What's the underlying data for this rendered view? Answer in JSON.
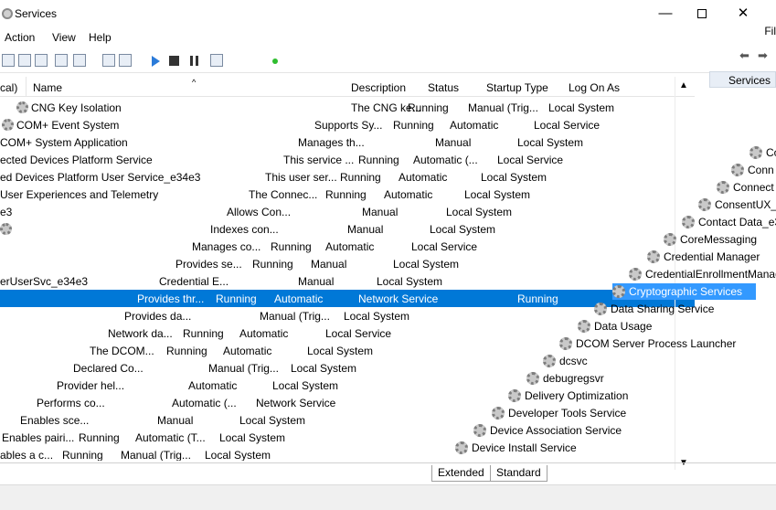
{
  "window": {
    "title": "Services",
    "minimize_glyph": "—",
    "close_glyph": "✕"
  },
  "menu": {
    "action": "Action",
    "view": "View",
    "help": "Help",
    "right_fragment": "Fil"
  },
  "columns": {
    "name_fragment": "cal)",
    "name": "Name",
    "description": "Description",
    "status": "Status",
    "startup_type": "Startup Type",
    "log_on_as": "Log On As"
  },
  "rows": [
    {
      "name": "CNG Key Isolation",
      "desc": "The CNG ke...",
      "status": "Running",
      "startup": "Manual (Trig...",
      "logon": "Local System"
    },
    {
      "name": "COM+ Event System",
      "desc": "Supports Sy...",
      "status": "Running",
      "startup": "Automatic",
      "logon": "Local Service"
    },
    {
      "name": "COM+ System Application",
      "desc": "Manages th...",
      "status": "",
      "startup": "Manual",
      "logon": "Local System"
    },
    {
      "name": "ected Devices Platform Service",
      "desc": "This service ...",
      "status": "Running",
      "startup": "Automatic (...",
      "logon": "Local Service"
    },
    {
      "name": "ed Devices Platform User Service_e34e3",
      "desc": "This user ser...",
      "status": "Running",
      "startup": "Automatic",
      "logon": "Local System"
    },
    {
      "name": "User Experiences and Telemetry",
      "desc": "The Connec...",
      "status": "Running",
      "startup": "Automatic",
      "logon": "Local System"
    },
    {
      "name": "e3",
      "desc": "Allows Con...",
      "status": "",
      "startup": "Manual",
      "logon": "Local System"
    },
    {
      "name": "",
      "desc": "Indexes con...",
      "status": "",
      "startup": "Manual",
      "logon": "Local System"
    },
    {
      "name": "",
      "desc": "Manages co...",
      "status": "Running",
      "startup": "Automatic",
      "logon": "Local Service"
    },
    {
      "name": "",
      "desc": "Provides se...",
      "status": "Running",
      "startup": "Manual",
      "logon": "Local System"
    },
    {
      "name": "erUserSvc_e34e3",
      "desc": "Credential E...",
      "status": "",
      "startup": "Manual",
      "logon": "Local System"
    },
    {
      "name": "",
      "desc": "Provides thr...",
      "status": "Running",
      "startup": "Automatic",
      "logon": "Network Service"
    },
    {
      "name": "",
      "desc": "Provides da...",
      "status": "",
      "startup": "Manual (Trig...",
      "logon": "Local System"
    },
    {
      "name": "",
      "desc": "Network da...",
      "status": "Running",
      "startup": "Automatic",
      "logon": "Local Service"
    },
    {
      "name": "",
      "desc": "The DCOM...",
      "status": "Running",
      "startup": "Automatic",
      "logon": "Local System"
    },
    {
      "name": "",
      "desc": "Declared Co...",
      "status": "",
      "startup": "Manual (Trig...",
      "logon": "Local System"
    },
    {
      "name": "",
      "desc": "Provider hel...",
      "status": "",
      "startup": "Automatic",
      "logon": "Local System"
    },
    {
      "name": "",
      "desc": "Performs co...",
      "status": "",
      "startup": "Automatic (...",
      "logon": "Network Service"
    },
    {
      "name": "",
      "desc": "Enables sce...",
      "status": "",
      "startup": "Manual",
      "logon": "Local System"
    },
    {
      "name": "",
      "desc": "Enables pairi...",
      "status": "Running",
      "startup": "Automatic (T...",
      "logon": "Local System"
    },
    {
      "name": "",
      "desc": "ables a c...",
      "status": "Running",
      "startup": "Manual (Trig...",
      "logon": "Local System"
    }
  ],
  "right_pane": {
    "header": "Services",
    "items": [
      "Co",
      "Conn",
      "Connect",
      "ConsentUX_e",
      "Contact Data_e3",
      "CoreMessaging",
      "Credential Manager",
      "CredentialEnrollmentManag",
      "Cryptographic Services",
      "Data Sharing Service",
      "Data Usage",
      "DCOM Server Process Launcher",
      "dcsvc",
      "debugregsvr",
      "Delivery Optimization",
      "Developer Tools Service",
      "Device Association Service",
      "Device Install Service"
    ],
    "selected_right_fragment_status": "Running"
  },
  "tabs": {
    "extended": "Extended",
    "standard": "Standard"
  },
  "colors": {
    "selection": "#0078d7",
    "selection_light": "#3399ff"
  }
}
